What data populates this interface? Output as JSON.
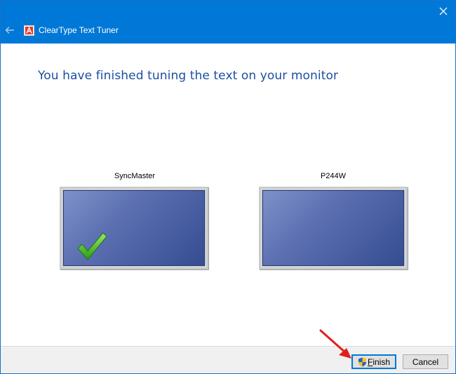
{
  "window": {
    "title": "ClearType Text Tuner",
    "icons": {
      "back": "back-arrow-icon",
      "app": "cleartype-app-icon",
      "close": "close-icon"
    }
  },
  "main": {
    "heading": "You have finished tuning the text on your monitor",
    "monitors": [
      {
        "label": "SyncMaster",
        "selected": true
      },
      {
        "label": "P244W",
        "selected": false
      }
    ]
  },
  "footer": {
    "finish_prefix": "",
    "finish_mnemonic": "F",
    "finish_rest": "inish",
    "cancel_label": "Cancel"
  },
  "colors": {
    "titlebar": "#0078d7",
    "heading": "#1c4fa0",
    "annotation_arrow": "#e0201c",
    "checkmark": "#3fb21f"
  }
}
